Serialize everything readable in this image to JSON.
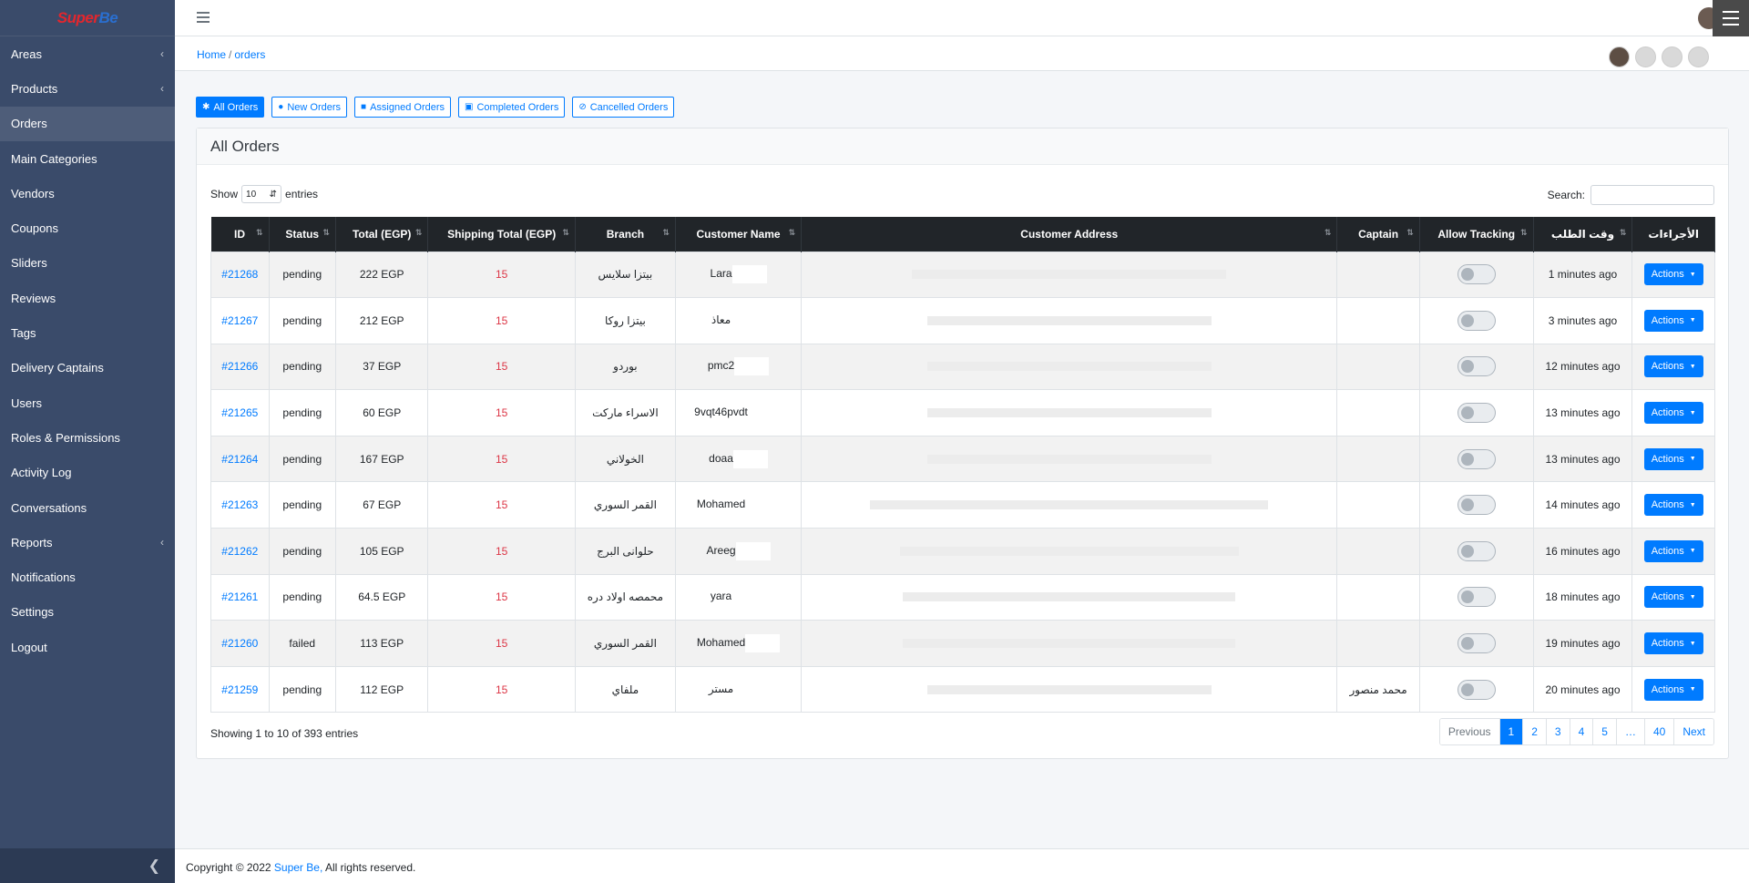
{
  "brand": {
    "part1": "Super",
    "part2": "Be"
  },
  "sidebar": {
    "items": [
      {
        "label": "Areas",
        "chevron": true
      },
      {
        "label": "Products",
        "chevron": true
      },
      {
        "label": "Orders",
        "chevron": false,
        "active": true
      },
      {
        "label": "Main Categories",
        "chevron": false
      },
      {
        "label": "Vendors",
        "chevron": false
      },
      {
        "label": "Coupons",
        "chevron": false
      },
      {
        "label": "Sliders",
        "chevron": false
      },
      {
        "label": "Reviews",
        "chevron": false
      },
      {
        "label": "Tags",
        "chevron": false
      },
      {
        "label": "Delivery Captains",
        "chevron": false
      },
      {
        "label": "Users",
        "chevron": false
      },
      {
        "label": "Roles & Permissions",
        "chevron": false
      },
      {
        "label": "Activity Log",
        "chevron": false
      },
      {
        "label": "Conversations",
        "chevron": false
      },
      {
        "label": "Reports",
        "chevron": true
      },
      {
        "label": "Notifications",
        "chevron": false
      },
      {
        "label": "Settings",
        "chevron": false
      },
      {
        "label": "Logout",
        "chevron": false
      }
    ],
    "collapse_icon": "chevron-left-icon"
  },
  "breadcrumb": {
    "home": "Home",
    "sep": "/",
    "current": "orders"
  },
  "filters": [
    {
      "label": "All Orders",
      "icon": "asterisk-icon",
      "active": true
    },
    {
      "label": "New Orders",
      "icon": "bulb-icon",
      "active": false
    },
    {
      "label": "Assigned Orders",
      "icon": "truck-icon",
      "active": false
    },
    {
      "label": "Completed Orders",
      "icon": "clipboard-check-icon",
      "active": false
    },
    {
      "label": "Cancelled Orders",
      "icon": "ban-icon",
      "active": false
    }
  ],
  "card": {
    "title": "All Orders"
  },
  "length": {
    "show": "Show",
    "value": "10",
    "entries": "entries"
  },
  "search": {
    "label": "Search:"
  },
  "table": {
    "headers": [
      "ID",
      "Status",
      "Total (EGP)",
      "Shipping Total (EGP)",
      "Branch",
      "Customer Name",
      "Customer Address",
      "Captain",
      "Allow Tracking",
      "وقت الطلب",
      "الأجراءات"
    ],
    "rows": [
      {
        "id": "#21268",
        "status": "pending",
        "total": "222 EGP",
        "ship": "15",
        "branch": "بيتزا سلايس",
        "customer": "Lara",
        "captain": "",
        "time": "1 minutes ago",
        "action": "Actions"
      },
      {
        "id": "#21267",
        "status": "pending",
        "total": "212 EGP",
        "ship": "15",
        "branch": "بيتزا روكا",
        "customer": "معاذ",
        "captain": "",
        "time": "3 minutes ago",
        "action": "Actions"
      },
      {
        "id": "#21266",
        "status": "pending",
        "total": "37 EGP",
        "ship": "15",
        "branch": "بوردو",
        "customer": "pmc2",
        "captain": "",
        "time": "12 minutes ago",
        "action": "Actions"
      },
      {
        "id": "#21265",
        "status": "pending",
        "total": "60 EGP",
        "ship": "15",
        "branch": "الاسراء ماركت",
        "customer": "9vqt46pvdt",
        "captain": "",
        "time": "13 minutes ago",
        "action": "Actions"
      },
      {
        "id": "#21264",
        "status": "pending",
        "total": "167 EGP",
        "ship": "15",
        "branch": "الخولاني",
        "customer": "doaa",
        "captain": "",
        "time": "13 minutes ago",
        "action": "Actions"
      },
      {
        "id": "#21263",
        "status": "pending",
        "total": "67 EGP",
        "ship": "15",
        "branch": "القمر السوري",
        "customer": "Mohamed",
        "captain": "",
        "time": "14 minutes ago",
        "action": "Actions"
      },
      {
        "id": "#21262",
        "status": "pending",
        "total": "105 EGP",
        "ship": "15",
        "branch": "حلوانى البرج",
        "customer": "Areeg",
        "captain": "",
        "time": "16 minutes ago",
        "action": "Actions"
      },
      {
        "id": "#21261",
        "status": "pending",
        "total": "64.5 EGP",
        "ship": "15",
        "branch": "محمصه اولاد دره",
        "customer": "yara",
        "captain": "",
        "time": "18 minutes ago",
        "action": "Actions"
      },
      {
        "id": "#21260",
        "status": "failed",
        "total": "113 EGP",
        "ship": "15",
        "branch": "القمر السوري",
        "customer": "Mohamed",
        "captain": "",
        "time": "19 minutes ago",
        "action": "Actions"
      },
      {
        "id": "#21259",
        "status": "pending",
        "total": "112 EGP",
        "ship": "15",
        "branch": "ملفاي",
        "customer": "مستر",
        "captain": "محمد منصور",
        "time": "20 minutes ago",
        "action": "Actions"
      }
    ]
  },
  "info": "Showing 1 to 10 of 393 entries",
  "pager": [
    "Previous",
    "1",
    "2",
    "3",
    "4",
    "5",
    "…",
    "40",
    "Next"
  ],
  "pager_current": "1",
  "footer": {
    "prefix": "Copyright © 2022",
    "brand": "Super Be,",
    "suffix": "All rights reserved."
  }
}
